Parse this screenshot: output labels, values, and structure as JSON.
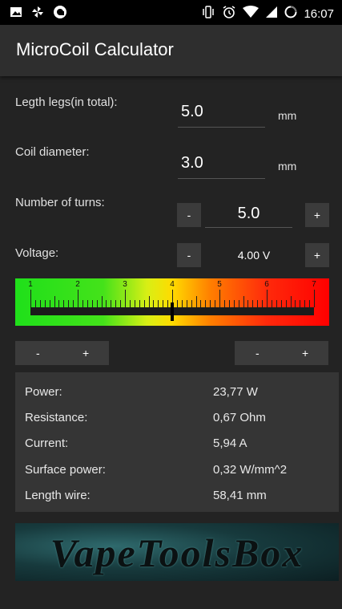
{
  "status_bar": {
    "time": "16:07",
    "left_icons": [
      "image-icon",
      "pinwheel-icon",
      "app-icon"
    ],
    "right_icons": [
      "vibrate-icon",
      "alarm-icon",
      "wifi-icon",
      "signal-icon",
      "battery-icon"
    ]
  },
  "app": {
    "title": "MicroCoil Calculator"
  },
  "inputs": {
    "legs": {
      "label": "Legth legs(in total):",
      "value": "5.0",
      "unit": "mm"
    },
    "diameter": {
      "label": "Coil diameter:",
      "value": "3.0",
      "unit": "mm"
    },
    "turns": {
      "label": "Number of turns:",
      "value": "5.0",
      "minus": "-",
      "plus": "+"
    },
    "voltage": {
      "label": "Voltage:",
      "value": "4.00 V",
      "minus": "-",
      "plus": "+"
    }
  },
  "slider": {
    "ticks": [
      "1",
      "2",
      "3",
      "4",
      "5",
      "6",
      "7"
    ],
    "min": 1,
    "max": 7,
    "position": 4.0
  },
  "fine_buttons": {
    "left_minus": "-",
    "left_plus": "+",
    "right_minus": "-",
    "right_plus": "+"
  },
  "results": [
    {
      "label": "Power:",
      "value": "23,77 W"
    },
    {
      "label": "Resistance:",
      "value": "0,67 Ohm"
    },
    {
      "label": "Current:",
      "value": "5,94 A"
    },
    {
      "label": "Surface power:",
      "value": "0,32 W/mm^2"
    },
    {
      "label": "Length wire:",
      "value": "58,41 mm"
    }
  ],
  "banner": {
    "text": "VapeToolsBox"
  }
}
